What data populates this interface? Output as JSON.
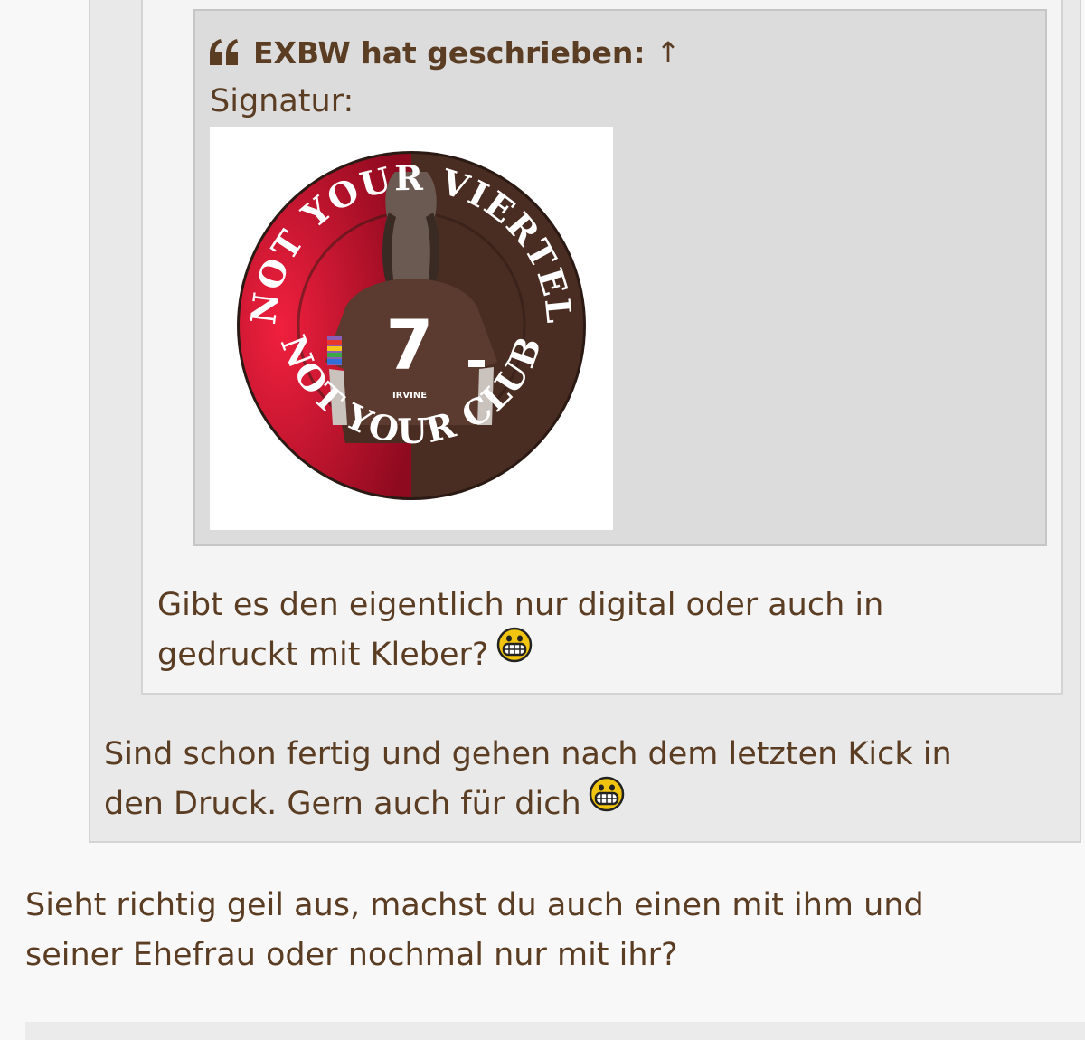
{
  "quote": {
    "author_line": "EXBW hat geschrieben:",
    "jump_arrow": "↑",
    "quote_icon": "quote-icon",
    "signatur_label": "Signatur:"
  },
  "signature_image": {
    "top_text": "NOT YOUR VIERTEL",
    "bottom_text": "NOT YOUR CLUB",
    "shirt_number": "7",
    "shirt_name": "IRVINE",
    "colors": {
      "red": "#c8102e",
      "brown": "#4a2d22",
      "white": "#ffffff"
    }
  },
  "middle_post": {
    "lines": [
      "Gibt es den eigentlich nur digital oder auch in",
      "gedruckt mit Kleber?"
    ],
    "smiley": "grinning-smiley-icon"
  },
  "outer_post": {
    "lines": [
      "Sind schon fertig und gehen nach dem letzten Kick in",
      "den Druck. Gern auch für dich"
    ],
    "smiley": "grinning-smiley-icon"
  },
  "reply": {
    "lines": [
      "Sieht richtig geil aus, machst du auch einen mit ihm und",
      "seiner Ehefrau oder nochmal nur mit ihr?"
    ]
  },
  "colors": {
    "text": "#5a3d23",
    "page_bg": "#f9f8f8",
    "outer_quote_bg": "#e9e9e9",
    "middle_quote_bg": "#f4f4f4",
    "inner_quote_bg": "#dcdcdc"
  }
}
